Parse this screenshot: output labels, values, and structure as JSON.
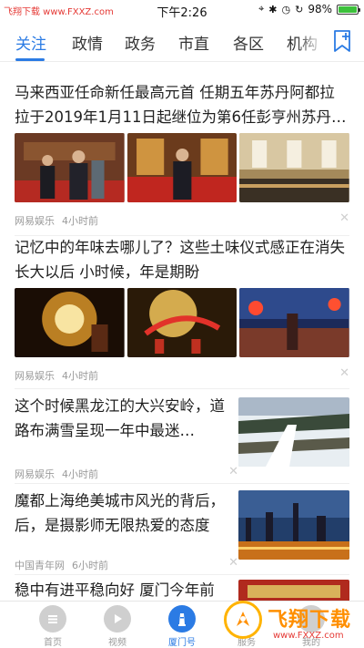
{
  "status_bar": {
    "watermark": "飞翔下载 www.FXXZ.com",
    "time": "下午2:26",
    "battery": "98%",
    "battery_level": 0.98
  },
  "tabs": {
    "items": [
      "关注",
      "政情",
      "政务",
      "市直",
      "各区",
      "机构"
    ],
    "active_index": 0,
    "add_icon": "add-channel-icon"
  },
  "articles": [
    {
      "title": "马来西亚任命新任最高元首 任期五年苏丹阿都拉拉于2019年1月11日起继位为第6任彭亨州苏丹…",
      "images": 3,
      "source": "网易娱乐",
      "time": "4小时前"
    },
    {
      "title": "记忆中的年味去哪儿了？这些土味仪式感正在消失 长大以后 小时候，年是期盼",
      "images": 3,
      "source": "网易娱乐",
      "time": "4小时前"
    },
    {
      "title": "这个时候黑龙江的大兴安岭，道路布满雪呈现一年中最迷…",
      "images": 1,
      "source": "网易娱乐",
      "time": "4小时前"
    },
    {
      "title": "魔都上海绝美城市风光的背后，后，是摄影师无限热爱的态度",
      "images": 1,
      "source": "中国青年网",
      "time": "6小时前"
    },
    {
      "title": "稳中有进平稳向好 厦门今年前",
      "images": 1,
      "source": "",
      "time": ""
    }
  ],
  "bottom_nav": {
    "items": [
      {
        "label": "首页",
        "icon": "home-icon"
      },
      {
        "label": "视频",
        "icon": "play-icon"
      },
      {
        "label": "厦门号",
        "icon": "lighthouse-icon"
      },
      {
        "label": "服务",
        "icon": "service-icon"
      },
      {
        "label": "我的",
        "icon": "profile-icon"
      }
    ],
    "active_index": 2
  },
  "logo_watermark": {
    "text": "飞翔下载",
    "url": "www.FXXZ.com"
  },
  "colors": {
    "accent": "#2b7be4",
    "meta_text": "#9a9a9a",
    "watermark_red": "#e53935"
  }
}
